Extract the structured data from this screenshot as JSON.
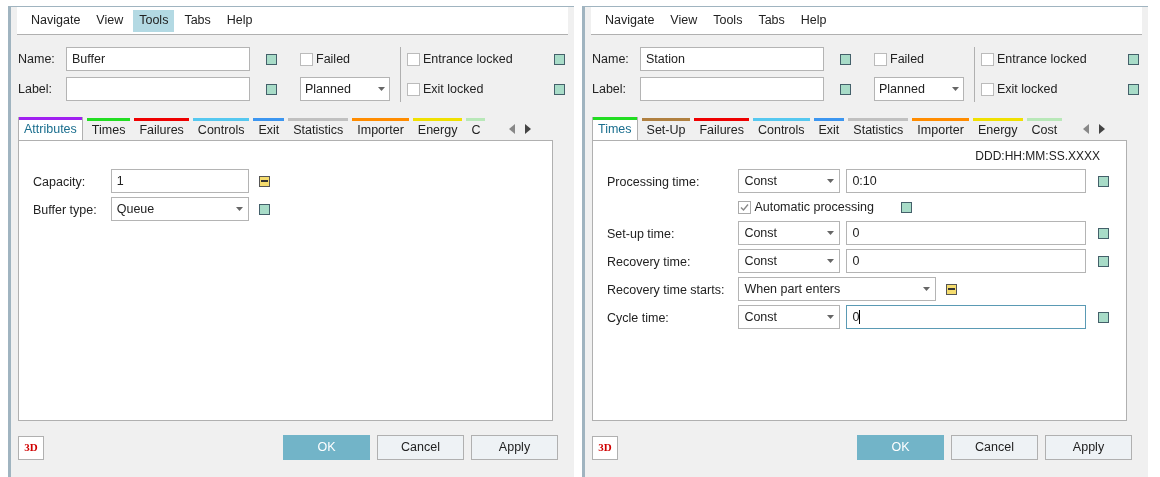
{
  "dialogs": [
    {
      "menu": [
        {
          "label": "Navigate",
          "selected": false
        },
        {
          "label": "View",
          "selected": false
        },
        {
          "label": "Tools",
          "selected": true
        },
        {
          "label": "Tabs",
          "selected": false
        },
        {
          "label": "Help",
          "selected": false
        }
      ],
      "name": {
        "label": "Name:",
        "value": "Buffer",
        "marker": false
      },
      "label": {
        "label": "Label:",
        "marker": false
      },
      "failed": {
        "label": "Failed",
        "checked": false
      },
      "status": {
        "value": "Planned"
      },
      "entrance_locked": {
        "label": "Entrance locked",
        "checked": false,
        "marker": false
      },
      "exit_locked": {
        "label": "Exit locked",
        "checked": false,
        "marker": false
      },
      "tabs": [
        {
          "label": "Attributes",
          "color": "#a020f0",
          "selected": true
        },
        {
          "label": "Times",
          "color": "#22dd22",
          "selected": false
        },
        {
          "label": "Failures",
          "color": "#ee0000",
          "selected": false
        },
        {
          "label": "Controls",
          "color": "#55c8f0",
          "selected": false
        },
        {
          "label": "Exit",
          "color": "#3c96f0",
          "selected": false
        },
        {
          "label": "Statistics",
          "color": "#c0c0c0",
          "selected": false
        },
        {
          "label": "Importer",
          "color": "#ff8c00",
          "selected": false
        },
        {
          "label": "Energy",
          "color": "#f0e000",
          "selected": false
        },
        {
          "label": "C",
          "color": "#b8e8b8",
          "selected": false
        }
      ],
      "fields": [
        {
          "kind": "text",
          "label": "Capacity:",
          "value": "1",
          "marker": true
        },
        {
          "kind": "dropdown",
          "label": "Buffer type:",
          "value": "Queue",
          "marker": false
        }
      ],
      "three_d": "3D",
      "buttons": [
        {
          "label": "OK",
          "primary": true
        },
        {
          "label": "Cancel",
          "primary": false
        },
        {
          "label": "Apply",
          "primary": false
        }
      ]
    },
    {
      "menu": [
        {
          "label": "Navigate",
          "selected": false
        },
        {
          "label": "View",
          "selected": false
        },
        {
          "label": "Tools",
          "selected": false
        },
        {
          "label": "Tabs",
          "selected": false
        },
        {
          "label": "Help",
          "selected": false
        }
      ],
      "name": {
        "label": "Name:",
        "value": "Station",
        "marker": false
      },
      "label": {
        "label": "Label:",
        "marker": false
      },
      "failed": {
        "label": "Failed",
        "checked": false
      },
      "status": {
        "value": "Planned"
      },
      "entrance_locked": {
        "label": "Entrance locked",
        "checked": false,
        "marker": false
      },
      "exit_locked": {
        "label": "Exit locked",
        "checked": false,
        "marker": false
      },
      "tabs": [
        {
          "label": "Times",
          "color": "#22dd22",
          "selected": true
        },
        {
          "label": "Set-Up",
          "color": "#b08040",
          "selected": false
        },
        {
          "label": "Failures",
          "color": "#ee0000",
          "selected": false
        },
        {
          "label": "Controls",
          "color": "#55c8f0",
          "selected": false
        },
        {
          "label": "Exit",
          "color": "#3c96f0",
          "selected": false
        },
        {
          "label": "Statistics",
          "color": "#c0c0c0",
          "selected": false
        },
        {
          "label": "Importer",
          "color": "#ff8c00",
          "selected": false
        },
        {
          "label": "Energy",
          "color": "#f0e000",
          "selected": false
        },
        {
          "label": "Cost",
          "color": "#b8e8b8",
          "selected": false
        }
      ],
      "format_hint": "DDD:HH:MM:SS.XXXX",
      "fields": [
        {
          "kind": "mode_value",
          "label": "Processing time:",
          "mode": "Const",
          "value": "0:10",
          "focused": false,
          "marker": false
        },
        {
          "kind": "checkbox",
          "label": "Automatic processing",
          "checked": true,
          "marker": false
        },
        {
          "kind": "mode_value",
          "label": "Set-up time:",
          "mode": "Const",
          "value": "0",
          "focused": false,
          "marker": false
        },
        {
          "kind": "mode_value",
          "label": "Recovery time:",
          "mode": "Const",
          "value": "0",
          "focused": false,
          "marker": false
        },
        {
          "kind": "wide_dropdown",
          "label": "Recovery time starts:",
          "value": "When part enters",
          "marker": true
        },
        {
          "kind": "mode_value",
          "label": "Cycle time:",
          "mode": "Const",
          "value": "0",
          "focused": true,
          "marker": false
        }
      ],
      "three_d": "3D",
      "buttons": [
        {
          "label": "OK",
          "primary": true
        },
        {
          "label": "Cancel",
          "primary": false
        },
        {
          "label": "Apply",
          "primary": false
        }
      ]
    }
  ]
}
